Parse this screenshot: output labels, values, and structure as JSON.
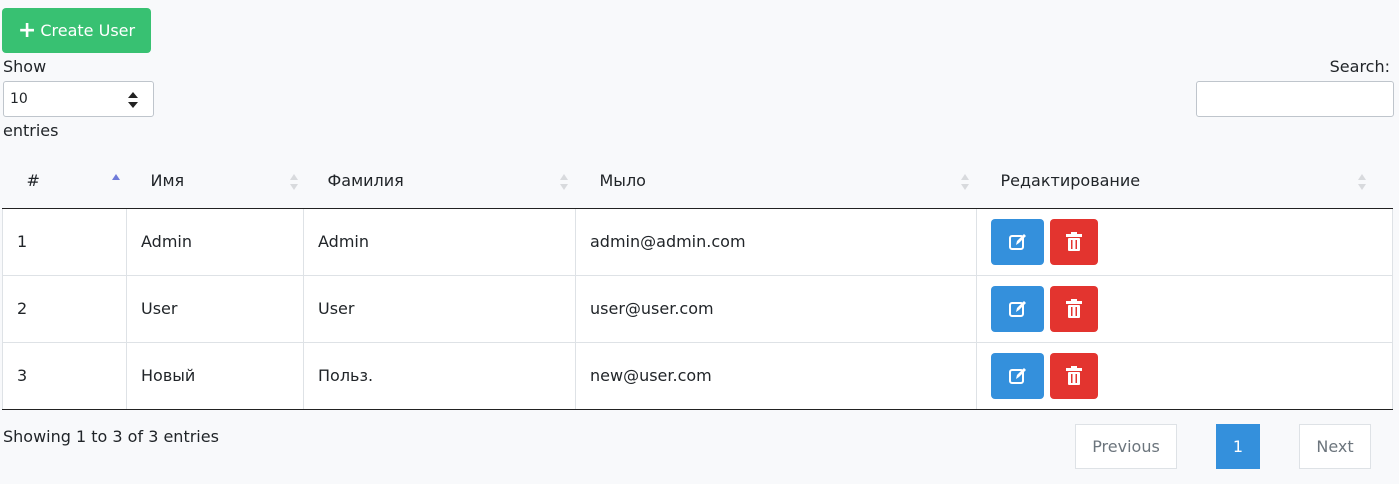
{
  "toolbar": {
    "create_label": "Create User",
    "create_icon": "plus-icon"
  },
  "length": {
    "show_label": "Show",
    "selected": "10",
    "entries_label": "entries"
  },
  "search": {
    "label": "Search:",
    "value": ""
  },
  "table": {
    "headers": [
      "#",
      "Имя",
      "Фамилия",
      "Мыло",
      "Редактирование"
    ],
    "rows": [
      [
        "1",
        "Admin",
        "Admin",
        "admin@admin.com"
      ],
      [
        "2",
        "User",
        "User",
        "user@user.com"
      ],
      [
        "3",
        "Новый",
        "Польз.",
        "new@user.com"
      ]
    ]
  },
  "footer": {
    "info": "Showing 1 to 3 of 3 entries",
    "previous": "Previous",
    "page": "1",
    "next": "Next"
  },
  "colors": {
    "success": "#38c172",
    "primary": "#3490dc",
    "danger": "#e3342f"
  }
}
